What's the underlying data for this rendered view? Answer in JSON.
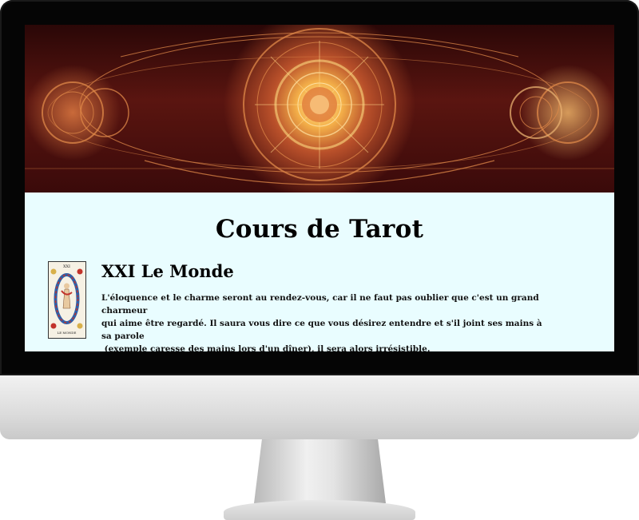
{
  "page": {
    "title": "Cours de Tarot"
  },
  "card": {
    "heading": "XXI Le Monde",
    "lines": [
      "L'éloquence et le charme seront au rendez-vous, car il ne faut pas oublier que c'est un grand charmeur",
      "qui aime être regardé. Il saura vous dire ce que vous désirez entendre et s'il joint ses mains à sa parole",
      " (exemple caresse des mains lors d'un dîner), il sera alors irrésistible."
    ],
    "thumb_top_label": "XXI",
    "thumb_bottom_label": "LE MONDE"
  },
  "colors": {
    "screen_background": "#e9fdff",
    "bezel": "#050505",
    "banner_glow": "#f5b24a"
  },
  "icons": {
    "banner": "tarot-mandala-banner",
    "card": "tarot-card-le-monde"
  }
}
